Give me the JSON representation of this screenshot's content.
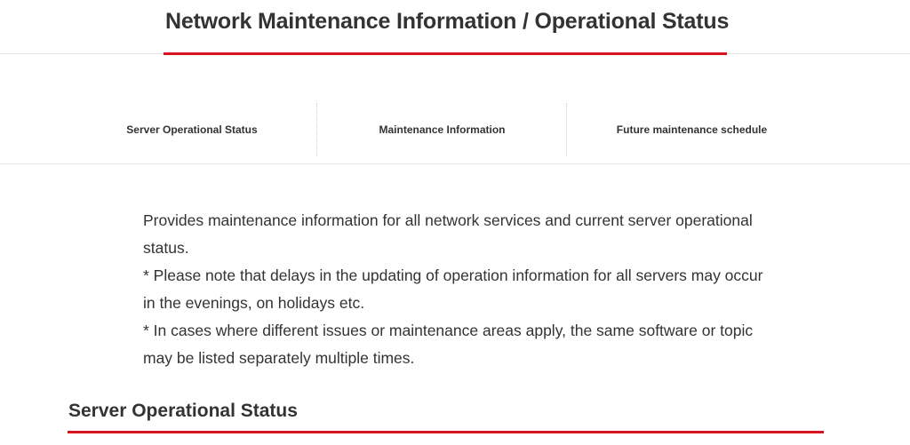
{
  "header": {
    "title": "Network Maintenance Information / Operational Status",
    "accent_color": "#d7141e"
  },
  "tabs": [
    {
      "label": "Server Operational Status"
    },
    {
      "label": "Maintenance Information"
    },
    {
      "label": "Future maintenance schedule"
    }
  ],
  "intro": {
    "paragraph_1": "Provides maintenance information for all network services and current server operational status.",
    "paragraph_2": "* Please note that delays in the updating of operation information for all servers may occur in the evenings, on holidays etc.",
    "paragraph_3": "* In cases where different issues or maintenance areas apply, the same software or topic may be listed separately multiple times."
  },
  "section": {
    "title": "Server Operational Status"
  }
}
